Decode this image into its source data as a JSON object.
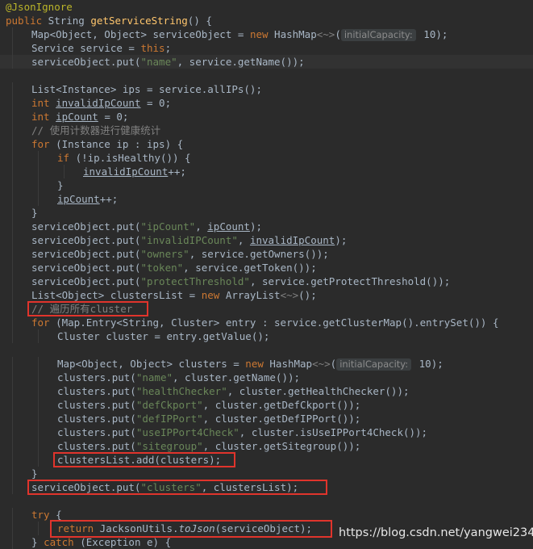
{
  "editor": {
    "watermark": "https://blog.csdn.net/yangwei234",
    "lines": [
      {
        "indent": 0,
        "tokens": [
          {
            "t": "@JsonIgnore",
            "c": "ann"
          }
        ]
      },
      {
        "indent": 0,
        "tokens": [
          {
            "t": "public",
            "c": "kw"
          },
          {
            "t": " String "
          },
          {
            "t": "getServiceString",
            "c": "fn"
          },
          {
            "t": "() {"
          }
        ]
      },
      {
        "indent": 1,
        "tokens": [
          {
            "t": "Map<Object, Object> serviceObject = "
          },
          {
            "t": "new",
            "c": "kw"
          },
          {
            "t": " HashMap"
          },
          {
            "t": "<~>",
            "c": "muted"
          },
          {
            "t": "("
          },
          {
            "t": "initialCapacity:",
            "c": "hint"
          },
          {
            "t": " 10);"
          }
        ]
      },
      {
        "indent": 1,
        "tokens": [
          {
            "t": "Service service = "
          },
          {
            "t": "this",
            "c": "kw"
          },
          {
            "t": ";"
          }
        ]
      },
      {
        "indent": 1,
        "tokens": [
          {
            "t": "serviceObject.put("
          },
          {
            "t": "\"name\"",
            "c": "str"
          },
          {
            "t": ", service.getName());"
          }
        ]
      },
      {
        "indent": 0,
        "tokens": []
      },
      {
        "indent": 1,
        "tokens": [
          {
            "t": "List<Instance> ips = service.allIPs();"
          }
        ]
      },
      {
        "indent": 1,
        "tokens": [
          {
            "t": "int",
            "c": "kw"
          },
          {
            "t": " "
          },
          {
            "t": "invalidIpCount",
            "c": "var"
          },
          {
            "t": " = 0;"
          }
        ]
      },
      {
        "indent": 1,
        "tokens": [
          {
            "t": "int",
            "c": "kw"
          },
          {
            "t": " "
          },
          {
            "t": "ipCount",
            "c": "var"
          },
          {
            "t": " = 0;"
          }
        ]
      },
      {
        "indent": 1,
        "tokens": [
          {
            "t": "// 使用计数器进行健康统计",
            "c": "cmt"
          }
        ]
      },
      {
        "indent": 1,
        "tokens": [
          {
            "t": "for",
            "c": "kw"
          },
          {
            "t": " (Instance ip : ips) {"
          }
        ]
      },
      {
        "indent": 2,
        "tokens": [
          {
            "t": "if",
            "c": "kw"
          },
          {
            "t": " (!ip.isHealthy()) {"
          }
        ]
      },
      {
        "indent": 3,
        "tokens": [
          {
            "t": "invalidIpCount",
            "c": "var"
          },
          {
            "t": "++;"
          }
        ]
      },
      {
        "indent": 2,
        "tokens": [
          {
            "t": "}"
          }
        ]
      },
      {
        "indent": 2,
        "tokens": [
          {
            "t": "ipCount",
            "c": "var"
          },
          {
            "t": "++;"
          }
        ]
      },
      {
        "indent": 1,
        "tokens": [
          {
            "t": "}"
          }
        ]
      },
      {
        "indent": 1,
        "tokens": [
          {
            "t": "serviceObject.put("
          },
          {
            "t": "\"ipCount\"",
            "c": "str"
          },
          {
            "t": ", "
          },
          {
            "t": "ipCount",
            "c": "var"
          },
          {
            "t": ");"
          }
        ]
      },
      {
        "indent": 1,
        "tokens": [
          {
            "t": "serviceObject.put("
          },
          {
            "t": "\"invalidIPCount\"",
            "c": "str"
          },
          {
            "t": ", "
          },
          {
            "t": "invalidIpCount",
            "c": "var"
          },
          {
            "t": ");"
          }
        ]
      },
      {
        "indent": 1,
        "tokens": [
          {
            "t": "serviceObject.put("
          },
          {
            "t": "\"owners\"",
            "c": "str"
          },
          {
            "t": ", service.getOwners());"
          }
        ]
      },
      {
        "indent": 1,
        "tokens": [
          {
            "t": "serviceObject.put("
          },
          {
            "t": "\"token\"",
            "c": "str"
          },
          {
            "t": ", service.getToken());"
          }
        ]
      },
      {
        "indent": 1,
        "tokens": [
          {
            "t": "serviceObject.put("
          },
          {
            "t": "\"protectThreshold\"",
            "c": "str"
          },
          {
            "t": ", service.getProtectThreshold());"
          }
        ]
      },
      {
        "indent": 1,
        "tokens": [
          {
            "t": "List<Object> clustersList = "
          },
          {
            "t": "new",
            "c": "kw"
          },
          {
            "t": " ArrayList"
          },
          {
            "t": "<~>",
            "c": "muted"
          },
          {
            "t": "();"
          }
        ]
      },
      {
        "indent": 1,
        "tokens": [
          {
            "t": "// 遍历所有cluster",
            "c": "cmt"
          }
        ]
      },
      {
        "indent": 1,
        "tokens": [
          {
            "t": "for",
            "c": "kw"
          },
          {
            "t": " (Map.Entry<String, Cluster> entry : service.getClusterMap().entrySet()) {"
          }
        ]
      },
      {
        "indent": 2,
        "tokens": [
          {
            "t": "Cluster cluster = entry.getValue();"
          }
        ]
      },
      {
        "indent": 0,
        "tokens": []
      },
      {
        "indent": 2,
        "tokens": [
          {
            "t": "Map<Object, Object> clusters = "
          },
          {
            "t": "new",
            "c": "kw"
          },
          {
            "t": " HashMap"
          },
          {
            "t": "<~>",
            "c": "muted"
          },
          {
            "t": "("
          },
          {
            "t": "initialCapacity:",
            "c": "hint"
          },
          {
            "t": " 10);"
          }
        ]
      },
      {
        "indent": 2,
        "tokens": [
          {
            "t": "clusters.put("
          },
          {
            "t": "\"name\"",
            "c": "str"
          },
          {
            "t": ", cluster.getName());"
          }
        ]
      },
      {
        "indent": 2,
        "tokens": [
          {
            "t": "clusters.put("
          },
          {
            "t": "\"healthChecker\"",
            "c": "str"
          },
          {
            "t": ", cluster.getHealthChecker());"
          }
        ]
      },
      {
        "indent": 2,
        "tokens": [
          {
            "t": "clusters.put("
          },
          {
            "t": "\"defCkport\"",
            "c": "str"
          },
          {
            "t": ", cluster.getDefCkport());"
          }
        ]
      },
      {
        "indent": 2,
        "tokens": [
          {
            "t": "clusters.put("
          },
          {
            "t": "\"defIPPort\"",
            "c": "str"
          },
          {
            "t": ", cluster.getDefIPPort());"
          }
        ]
      },
      {
        "indent": 2,
        "tokens": [
          {
            "t": "clusters.put("
          },
          {
            "t": "\"useIPPort4Check\"",
            "c": "str"
          },
          {
            "t": ", cluster.isUseIPPort4Check());"
          }
        ]
      },
      {
        "indent": 2,
        "tokens": [
          {
            "t": "clusters.put("
          },
          {
            "t": "\"sitegroup\"",
            "c": "str"
          },
          {
            "t": ", cluster.getSitegroup());"
          }
        ]
      },
      {
        "indent": 2,
        "tokens": [
          {
            "t": "clustersList.add(clusters);"
          }
        ]
      },
      {
        "indent": 1,
        "tokens": [
          {
            "t": "}"
          }
        ]
      },
      {
        "indent": 1,
        "tokens": [
          {
            "t": "serviceObject.put("
          },
          {
            "t": "\"clusters\"",
            "c": "str"
          },
          {
            "t": ", clustersList);"
          }
        ]
      },
      {
        "indent": 0,
        "tokens": []
      },
      {
        "indent": 1,
        "tokens": [
          {
            "t": "try",
            "c": "kw"
          },
          {
            "t": " {"
          }
        ]
      },
      {
        "indent": 2,
        "tokens": [
          {
            "t": "return",
            "c": "kw"
          },
          {
            "t": " JacksonUtils."
          },
          {
            "t": "toJson",
            "c": "ital"
          },
          {
            "t": "(serviceObject);"
          }
        ]
      },
      {
        "indent": 1,
        "tokens": [
          {
            "t": "} "
          },
          {
            "t": "catch",
            "c": "kw"
          },
          {
            "t": " (Exception e) {"
          }
        ]
      }
    ]
  }
}
